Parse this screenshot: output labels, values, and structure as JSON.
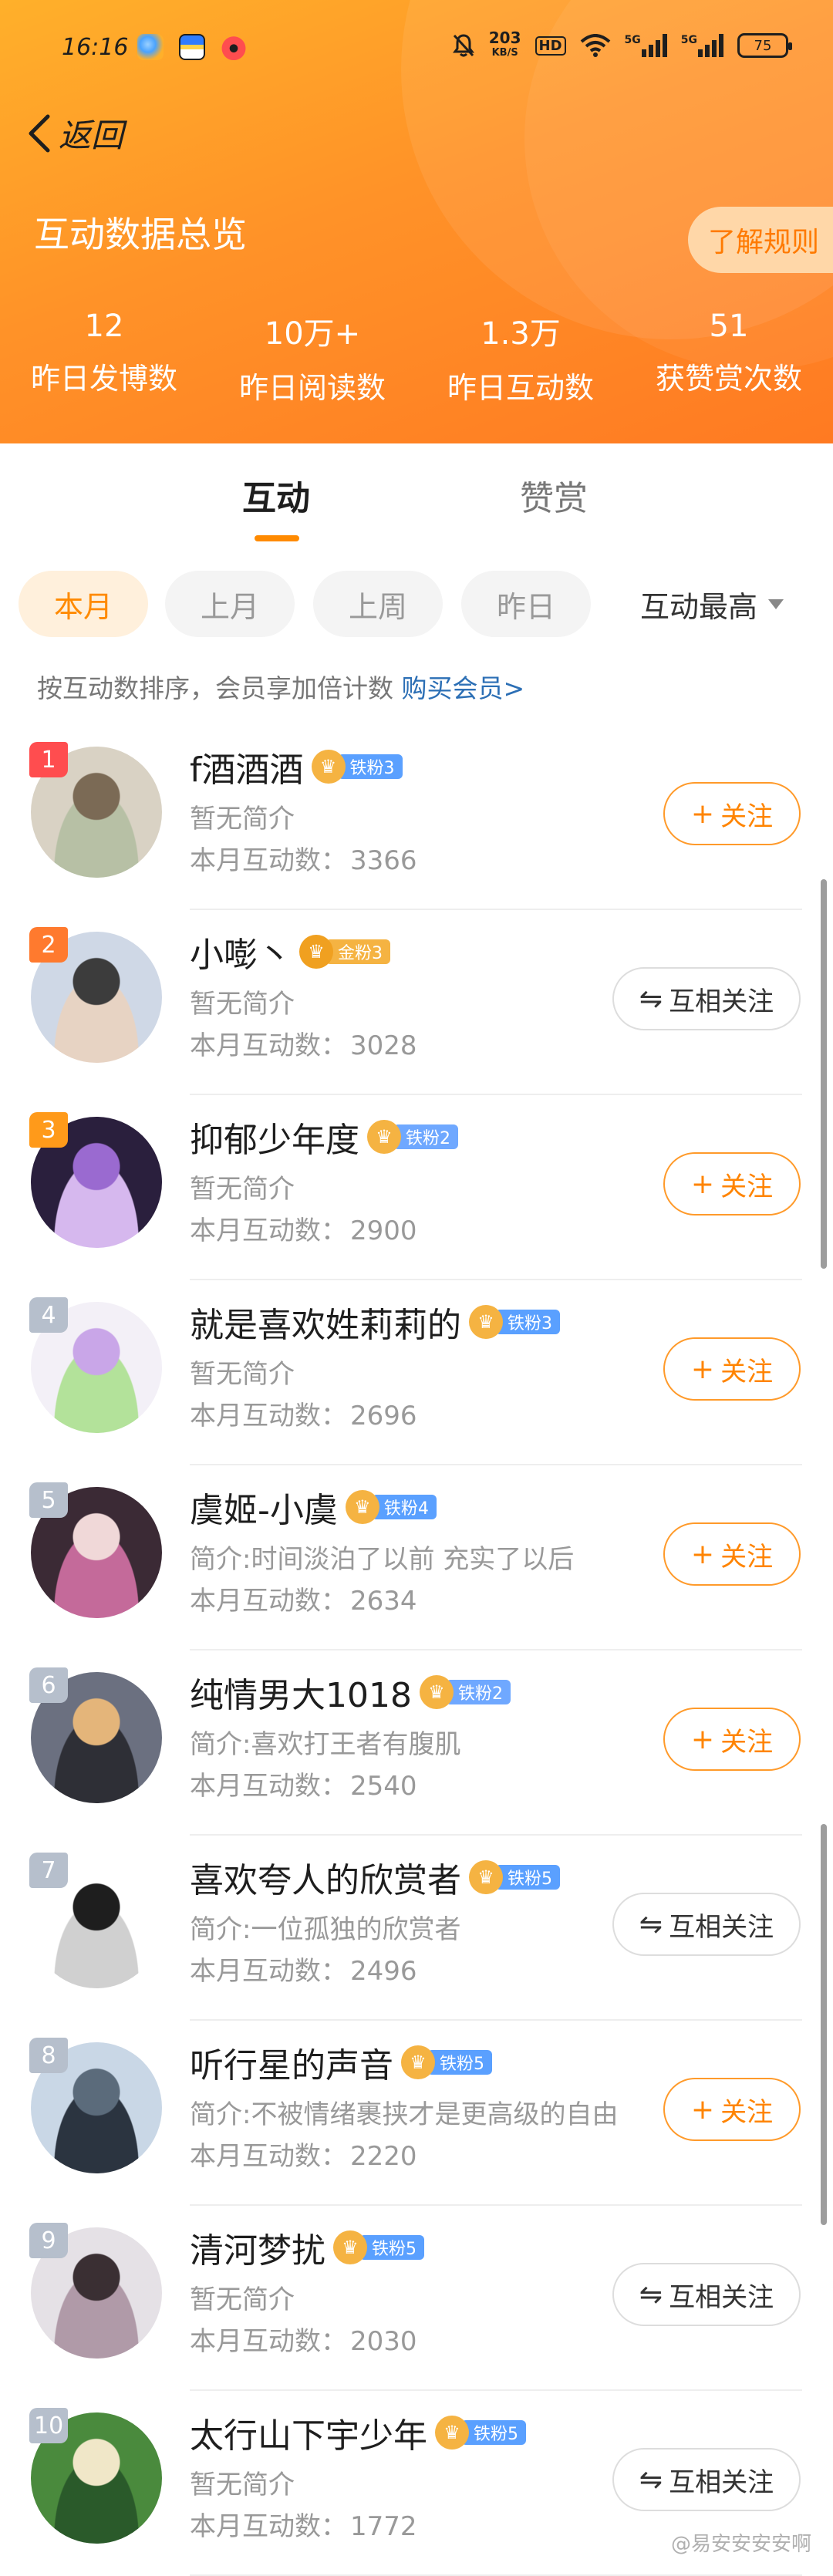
{
  "status_bar": {
    "time": "16:16",
    "net_speed_value": "203",
    "net_speed_unit": "KB/S",
    "hd_label": "HD",
    "signal_1_label": "5G",
    "signal_2_label": "5G",
    "battery": "75"
  },
  "nav": {
    "back_label": "返回"
  },
  "header": {
    "title": "互动数据总览",
    "rules_button": "了解规则",
    "stats": [
      {
        "value": "12",
        "label": "昨日发博数"
      },
      {
        "value": "10万+",
        "label": "昨日阅读数"
      },
      {
        "value": "1.3万",
        "label": "昨日互动数"
      },
      {
        "value": "51",
        "label": "获赞赏次数"
      }
    ]
  },
  "tabs": [
    {
      "label": "互动",
      "active": true
    },
    {
      "label": "赞赏",
      "active": false
    }
  ],
  "filters": {
    "chips": [
      "本月",
      "上月",
      "上周",
      "昨日"
    ],
    "active_chip": "本月",
    "sort_label": "互动最高"
  },
  "note": {
    "text": "按互动数排序，会员享加倍计数",
    "link": "购买会员>"
  },
  "count_label": "本月互动数：",
  "follow_label": "关注",
  "mutual_label": "互相关注",
  "users": [
    {
      "rank": "1",
      "name": "f酒酒酒",
      "badge": "铁粉3",
      "badge_color": "#5aa0ff",
      "intro": "暂无简介",
      "count": "3366",
      "follow_state": "follow",
      "rank_color": "#ff4d4f",
      "avatar_colors": [
        "#d9d2c4",
        "#7b6a55",
        "#b7c0a5"
      ]
    },
    {
      "rank": "2",
      "name": "小嘭丶",
      "badge": "金粉3",
      "badge_color": "#f5b342",
      "intro": "暂无简介",
      "count": "3028",
      "follow_state": "mutual",
      "rank_color": "#ff7a2e",
      "avatar_colors": [
        "#cfd8e6",
        "#3c3c3c",
        "#e7d3c3"
      ]
    },
    {
      "rank": "3",
      "name": "抑郁少年度",
      "badge": "铁粉2",
      "badge_color": "#6fa8ff",
      "intro": "暂无简介",
      "count": "2900",
      "follow_state": "follow",
      "rank_color": "#ff9a1a",
      "avatar_colors": [
        "#2a1f3d",
        "#9a6ad0",
        "#d6b8ee"
      ]
    },
    {
      "rank": "4",
      "name": "就是喜欢姓莉莉的",
      "badge": "铁粉3",
      "badge_color": "#5aa0ff",
      "intro": "暂无简介",
      "count": "2696",
      "follow_state": "follow",
      "rank_color": "#b6bfcc",
      "avatar_colors": [
        "#f3f0f7",
        "#c9a6e8",
        "#b3e29a"
      ]
    },
    {
      "rank": "5",
      "name": "虞姬-小虞",
      "badge": "铁粉4",
      "badge_color": "#5aa0ff",
      "intro": "简介:时间淡泊了以前 充实了以后",
      "count": "2634",
      "follow_state": "follow",
      "rank_color": "#b6bfcc",
      "avatar_colors": [
        "#3b2a35",
        "#f0d8d8",
        "#c46a9a"
      ]
    },
    {
      "rank": "6",
      "name": "纯情男大1018",
      "badge": "铁粉2",
      "badge_color": "#6fa8ff",
      "intro": "简介:喜欢打王者有腹肌",
      "count": "2540",
      "follow_state": "follow",
      "rank_color": "#b6bfcc",
      "avatar_colors": [
        "#6b7080",
        "#e4b57a",
        "#2e2f36"
      ]
    },
    {
      "rank": "7",
      "name": "喜欢夸人的欣赏者",
      "badge": "铁粉5",
      "badge_color": "#5aa0ff",
      "intro": "简介:一位孤独的欣赏者",
      "count": "2496",
      "follow_state": "mutual",
      "rank_color": "#b6bfcc",
      "avatar_colors": [
        "#ffffff",
        "#1e1e1e",
        "#d0d0d0"
      ]
    },
    {
      "rank": "8",
      "name": "听行星的声音",
      "badge": "铁粉5",
      "badge_color": "#5aa0ff",
      "intro": "简介:不被情绪裹挟才是更高级的自由",
      "count": "2220",
      "follow_state": "follow",
      "rank_color": "#b6bfcc",
      "avatar_colors": [
        "#c9d7e6",
        "#5b6b7b",
        "#2b3440"
      ]
    },
    {
      "rank": "9",
      "name": "清河梦扰",
      "badge": "铁粉5",
      "badge_color": "#5aa0ff",
      "intro": "暂无简介",
      "count": "2030",
      "follow_state": "mutual",
      "rank_color": "#b6bfcc",
      "avatar_colors": [
        "#e5e1e6",
        "#3a2f33",
        "#b09aa8"
      ]
    },
    {
      "rank": "10",
      "name": "太行山下宇少年",
      "badge": "铁粉5",
      "badge_color": "#5aa0ff",
      "intro": "暂无简介",
      "count": "1772",
      "follow_state": "mutual",
      "rank_color": "#b6bfcc",
      "avatar_colors": [
        "#4a8a3d",
        "#f0e7c8",
        "#2a5a2a"
      ]
    }
  ],
  "watermark": "@易安安安安啊"
}
